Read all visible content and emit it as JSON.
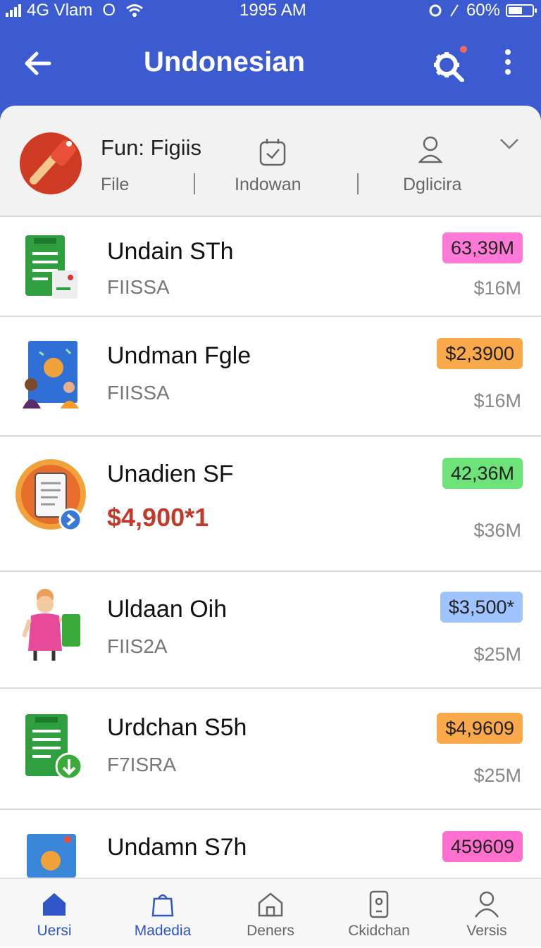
{
  "status_bar": {
    "signal": "4G Vlam",
    "extra": "O",
    "time": "1995 AM",
    "battery": "60%",
    "battery_level": 0.6
  },
  "app_bar": {
    "title": "Undonesian",
    "back_icon": "arrow-left-icon",
    "settings_icon": "gear-icon",
    "menu_icon": "more-vertical-icon"
  },
  "filter_bar": {
    "title": "Fun: Figiis",
    "col1": "File",
    "col2": "Indowan",
    "col3": "Dglicira"
  },
  "items": [
    {
      "name": "Undain STh",
      "sub": "FIISSA",
      "badge": "63,39M",
      "badge_color": "#ff7ad6",
      "value": "$16M"
    },
    {
      "name": "Undman Fgle",
      "sub": "FIISSA",
      "badge": "$2,3900",
      "badge_color": "#f9a84a",
      "value": "$16M"
    },
    {
      "name": "Unadien SF",
      "sub": "$4,900*1",
      "badge": "42,36M",
      "badge_color": "#6ee37a",
      "value": "$36M"
    },
    {
      "name": "Uldaan Oih",
      "sub": "FIIS2A",
      "badge": "$3,500*",
      "badge_color": "#9fc3ff",
      "value": "$25M"
    },
    {
      "name": "Urdchan S5h",
      "sub": "F7ISRA",
      "badge": "$4,9609",
      "badge_color": "#f9a84a",
      "value": "$25M"
    },
    {
      "name": "Undamn S7h",
      "sub": "",
      "badge": "459609",
      "badge_color": "#ff6fce",
      "value": ""
    }
  ],
  "bottom_nav": [
    {
      "label": "Uersi",
      "icon": "home-icon",
      "active": true
    },
    {
      "label": "Madedia",
      "icon": "bag-icon",
      "active": true
    },
    {
      "label": "Deners",
      "icon": "house-icon",
      "active": false
    },
    {
      "label": "Ckidchan",
      "icon": "phone-icon",
      "active": false
    },
    {
      "label": "Versis",
      "icon": "person-icon",
      "active": false
    }
  ]
}
